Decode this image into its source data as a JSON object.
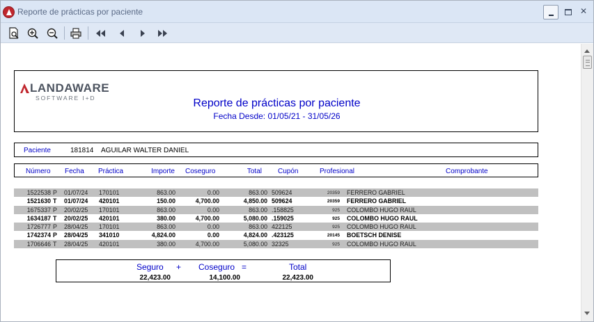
{
  "window": {
    "title": "Reporte de prácticas por paciente",
    "close_glyph": "✕"
  },
  "toolbar": {
    "icons": [
      "page-preview-icon",
      "zoom-in-icon",
      "zoom-out-icon",
      "print-icon",
      "first-page-icon",
      "previous-page-icon",
      "next-page-icon",
      "last-page-icon"
    ]
  },
  "report": {
    "logo_name": "LANDAWARE",
    "logo_sub": "SOFTWARE I+D",
    "title": "Reporte de prácticas por paciente",
    "subtitle": "Fecha Desde: 01/05/21 - 31/05/26",
    "patient_label": "Paciente",
    "patient_id": "181814",
    "patient_name": "AGUILAR WALTER DANIEL",
    "columns": {
      "numero": "Número",
      "fecha": "Fecha",
      "practica": "Práctica",
      "importe": "Importe",
      "coseguro": "Coseguro",
      "total": "Total",
      "cupon": "Cupón",
      "profesional": "Profesional",
      "comprobante": "Comprobante"
    },
    "rows": [
      {
        "numero": "1522538",
        "tipo": "P",
        "fecha": "01/07/24",
        "practica": "170101",
        "importe": "863.00",
        "coseguro": "0.00",
        "total": "863.00",
        "cupon": "509624",
        "prof_code": "20359",
        "profesional": "FERRERO GABRIEL",
        "shaded": true,
        "bold": false
      },
      {
        "numero": "1521630",
        "tipo": "T",
        "fecha": "01/07/24",
        "practica": "420101",
        "importe": "150.00",
        "coseguro": "4,700.00",
        "total": "4,850.00",
        "cupon": "509624",
        "prof_code": "20359",
        "profesional": "FERRERO GABRIEL",
        "shaded": false,
        "bold": true
      },
      {
        "numero": "1675337",
        "tipo": "P",
        "fecha": "20/02/25",
        "practica": "170101",
        "importe": "863.00",
        "coseguro": "0.00",
        "total": "863.00",
        "cupon": ".158825",
        "prof_code": "925",
        "profesional": "COLOMBO HUGO RAUL",
        "shaded": true,
        "bold": false
      },
      {
        "numero": "1634187",
        "tipo": "T",
        "fecha": "20/02/25",
        "practica": "420101",
        "importe": "380.00",
        "coseguro": "4,700.00",
        "total": "5,080.00",
        "cupon": ".159025",
        "prof_code": "925",
        "profesional": "COLOMBO HUGO RAUL",
        "shaded": false,
        "bold": true
      },
      {
        "numero": "1726777",
        "tipo": "P",
        "fecha": "28/04/25",
        "practica": "170101",
        "importe": "863.00",
        "coseguro": "0.00",
        "total": "863.00",
        "cupon": "422125",
        "prof_code": "925",
        "profesional": "COLOMBO HUGO RAUL",
        "shaded": true,
        "bold": false
      },
      {
        "numero": "1742374",
        "tipo": "P",
        "fecha": "28/04/25",
        "practica": "341010",
        "importe": "4,824.00",
        "coseguro": "0.00",
        "total": "4,824.00",
        "cupon": ".423125",
        "prof_code": "20145",
        "profesional": "BOETSCH DENISE",
        "shaded": false,
        "bold": true
      },
      {
        "numero": "1706646",
        "tipo": "T",
        "fecha": "28/04/25",
        "practica": "420101",
        "importe": "380.00",
        "coseguro": "4,700.00",
        "total": "5,080.00",
        "cupon": "32325",
        "prof_code": "925",
        "profesional": "COLOMBO HUGO RAUL",
        "shaded": true,
        "bold": false
      }
    ],
    "totals": {
      "seguro_label": "Seguro",
      "plus": "+",
      "coseguro_label": "Coseguro",
      "equals": "=",
      "total_label": "Total",
      "seguro_value": "22,423.00",
      "coseguro_value": "14,100.00",
      "total_value": "22,423.00"
    }
  }
}
